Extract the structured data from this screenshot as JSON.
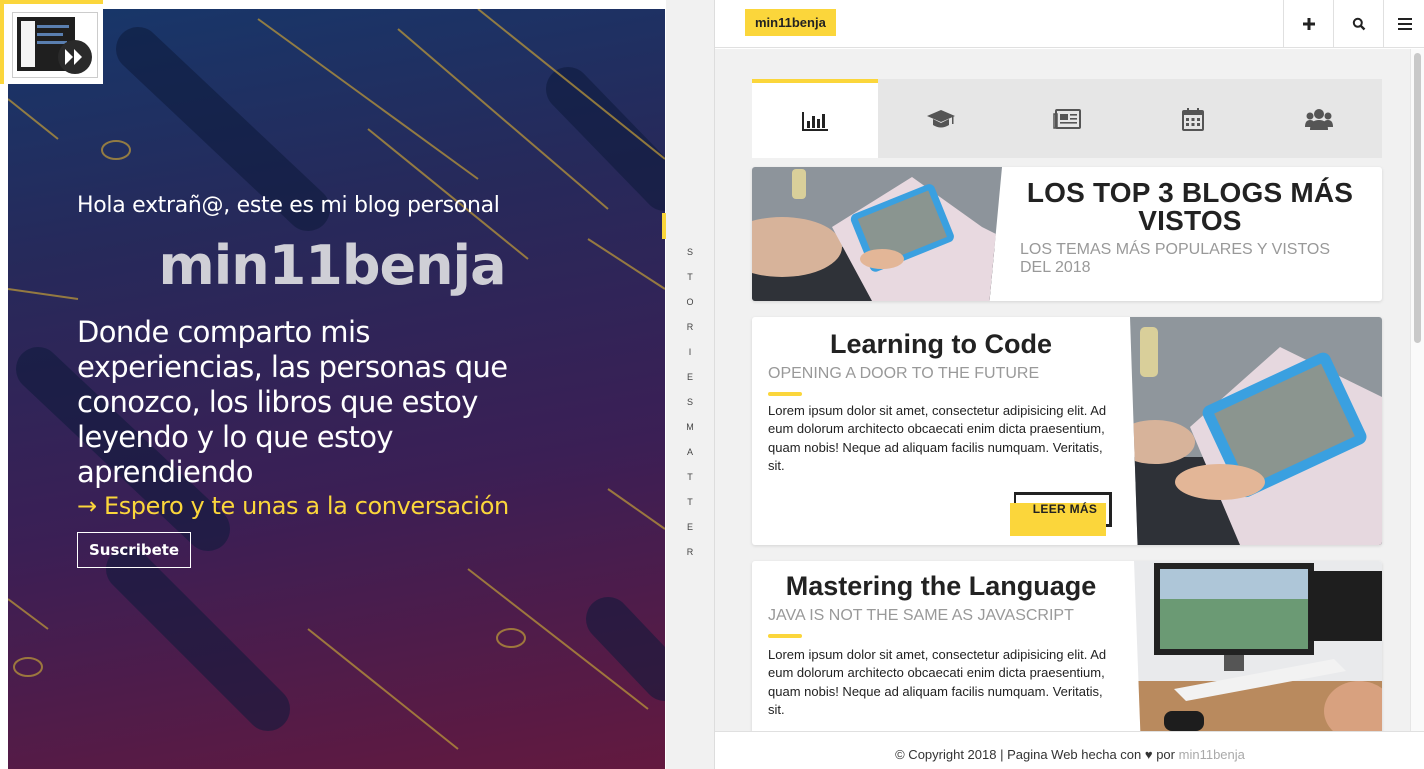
{
  "hero": {
    "greeting": "Hola extrañ@, este es mi blog personal",
    "brand": "min11benja",
    "description": "Donde comparto mis experiencias, las personas que conozco, los libros que estoy leyendo y lo que estoy aprendiendo",
    "cta_text": "→ Espero y te unas a la conversación",
    "subscribe_label": "Suscribete"
  },
  "strip": {
    "word1": [
      "S",
      "T",
      "O",
      "R",
      "I",
      "E",
      "S"
    ],
    "word2": [
      "M",
      "A",
      "T",
      "T",
      "E",
      "R"
    ]
  },
  "topbar": {
    "brand": "min11benja",
    "buttons": [
      "plus-icon",
      "search-icon",
      "menu-icon"
    ]
  },
  "tabs": [
    {
      "icon": "bar-chart-icon",
      "active": true
    },
    {
      "icon": "graduation-cap-icon",
      "active": false
    },
    {
      "icon": "newspaper-icon",
      "active": false
    },
    {
      "icon": "calendar-icon",
      "active": false
    },
    {
      "icon": "users-icon",
      "active": false
    }
  ],
  "featured": {
    "title": "LOS TOP 3 BLOGS MÁS VISTOS",
    "subtitle": "LOS TEMAS MÁS POPULARES Y VISTOS DEL 2018"
  },
  "posts": [
    {
      "title": "Learning to Code",
      "subtitle": "OPENING A DOOR TO THE FUTURE",
      "excerpt": "Lorem ipsum dolor sit amet, consectetur adipisicing elit. Ad eum dolorum architecto obcaecati enim dicta praesentium, quam nobis! Neque ad aliquam facilis numquam. Veritatis, sit.",
      "read_more": "LEER MÁS"
    },
    {
      "title": "Mastering the Language",
      "subtitle": "JAVA IS NOT THE SAME AS JAVASCRIPT",
      "excerpt": "Lorem ipsum dolor sit amet, consectetur adipisicing elit. Ad eum dolorum architecto obcaecati enim dicta praesentium, quam nobis! Neque ad aliquam facilis numquam. Veritatis, sit."
    }
  ],
  "footer": {
    "copyright": "© Copyright 2018 | Pagina Web hecha con ♥ por",
    "author": "min11benja"
  },
  "colors": {
    "accent": "#fbd63b",
    "hero_top": "#17376a",
    "hero_bottom": "#63193f"
  }
}
